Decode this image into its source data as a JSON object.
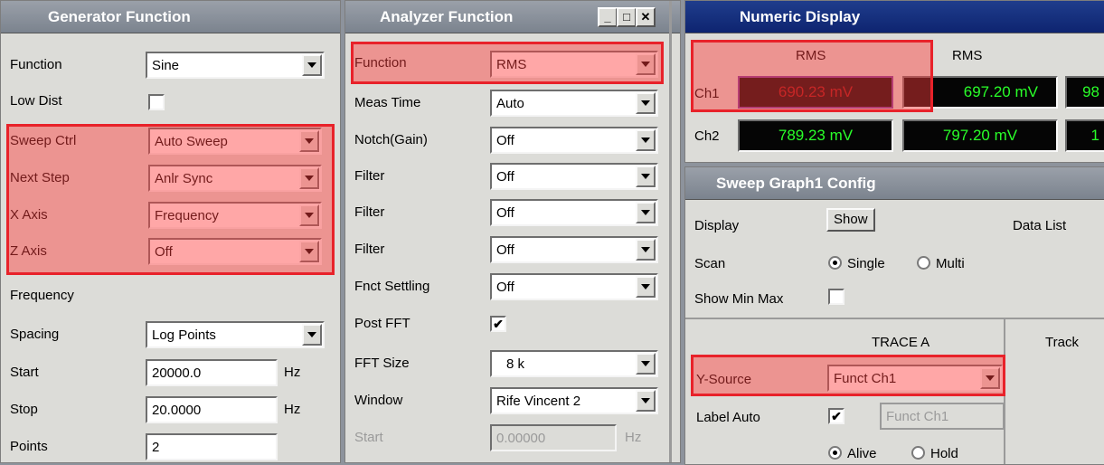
{
  "generator": {
    "title": "Generator Function",
    "rows": [
      {
        "label": "Function",
        "value": "Sine"
      },
      {
        "label": "Low Dist"
      },
      {
        "label": "Sweep Ctrl",
        "value": "Auto Sweep"
      },
      {
        "label": "Next Step",
        "value": "Anlr Sync"
      },
      {
        "label": "X Axis",
        "value": "Frequency"
      },
      {
        "label": "Z Axis",
        "value": "Off"
      },
      {
        "label": "Frequency"
      },
      {
        "label": "Spacing",
        "value": "Log Points"
      },
      {
        "label": "Start",
        "value": "20000.0",
        "unit": "Hz"
      },
      {
        "label": "Stop",
        "value": "20.0000",
        "unit": "Hz"
      },
      {
        "label": "Points",
        "value": "2"
      }
    ]
  },
  "analyzer": {
    "title": "Analyzer Function",
    "rows": [
      {
        "label": "Function",
        "value": "RMS"
      },
      {
        "label": "Meas Time",
        "value": "Auto"
      },
      {
        "label": "Notch(Gain)",
        "value": "Off"
      },
      {
        "label": "Filter",
        "value": "Off"
      },
      {
        "label": "Filter",
        "value": "Off"
      },
      {
        "label": "Filter",
        "value": "Off"
      },
      {
        "label": "Fnct Settling",
        "value": "Off"
      },
      {
        "label": "Post FFT",
        "checked": "✔"
      },
      {
        "label": "FFT Size",
        "value": "8 k"
      },
      {
        "label": "Window",
        "value": "Rife Vincent 2"
      },
      {
        "label": "Start",
        "value": "0.00000",
        "unit": "Hz"
      }
    ]
  },
  "numeric": {
    "title": "Numeric Display",
    "col1": "RMS",
    "col2": "RMS",
    "ch1": {
      "label": "Ch1",
      "v1": "690.23 mV",
      "v2": "697.20 mV",
      "v3": "98"
    },
    "ch2": {
      "label": "Ch2",
      "v1": "789.23 mV",
      "v2": "797.20 mV",
      "v3": "1"
    }
  },
  "sweep": {
    "title": "Sweep Graph1 Config",
    "display_label": "Display",
    "show_button": "Show",
    "data_list": "Data List",
    "scan_label": "Scan",
    "single": "Single",
    "multi": "Multi",
    "show_minmax": "Show Min Max",
    "trace_a": "TRACE A",
    "track": "Track",
    "ysource_label": "Y-Source",
    "ysource_value": "Funct Ch1",
    "label_auto": "Label Auto",
    "label_auto_checked": "✔",
    "label_field": "Funct Ch1",
    "alive": "Alive",
    "hold": "Hold"
  },
  "colors": {
    "highlight": "#e8222a",
    "meter_text": "#29ff29",
    "active_title": "#0e2470"
  }
}
